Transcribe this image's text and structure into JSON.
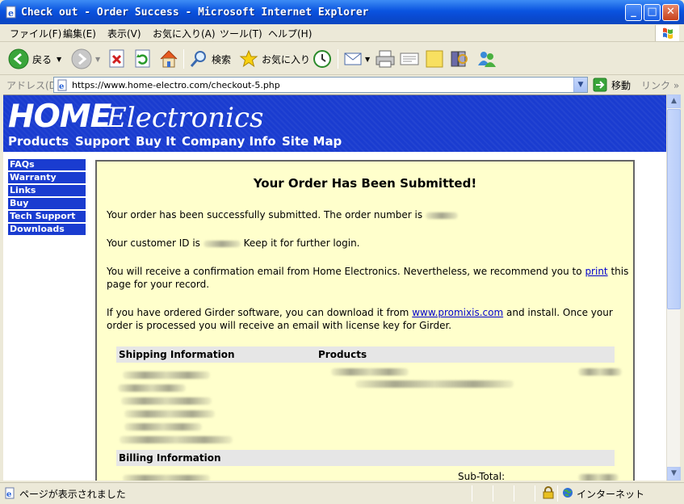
{
  "window": {
    "title": "Check out - Order Success - Microsoft Internet Explorer",
    "minimize": "_",
    "maximize": "□",
    "close": "✕"
  },
  "menu": [
    "ファイル(F)",
    "編集(E)",
    "表示(V)",
    "お気に入り(A)",
    "ツール(T)",
    "ヘルプ(H)"
  ],
  "toolbar": {
    "back_label": "戻る",
    "search_label": "検索",
    "favorites_label": "お気に入り"
  },
  "address": {
    "label": "アドレス(D)",
    "url": "https://www.home-electro.com/checkout-5.php",
    "go_label": "移動",
    "links_label": "リンク"
  },
  "site": {
    "logo_home": "HOME",
    "logo_electronics": "Electronics",
    "nav": [
      "Products",
      "Support",
      "Buy It",
      "Company Info",
      "Site Map"
    ],
    "side_nav": [
      "FAQs",
      "Warranty",
      "Links",
      "Buy",
      "Tech Support",
      "Downloads"
    ]
  },
  "content": {
    "heading": "Your Order Has Been Submitted!",
    "order_text": "Your order has been successfully submitted. The order number is",
    "customer_prefix": "Your customer ID is",
    "customer_suffix": "Keep it for further login.",
    "email_text": "You will receive a confirmation email from Home Electronics. Nevertheless, we recommend you to",
    "print_link": "print",
    "email_text_end": "this page for your record.",
    "girder_text": "If you have ordered Girder software, you can download it from",
    "girder_link": "www.promixis.com",
    "girder_text_end": "and install. Once your order is processed you will receive an email with license key for Girder.",
    "shipping_header": "Shipping Information",
    "products_header": "Products",
    "billing_header": "Billing Information",
    "subtotal_label": "Sub-Total:"
  },
  "status": {
    "text": "ページが表示されました",
    "zone": "インターネット"
  }
}
